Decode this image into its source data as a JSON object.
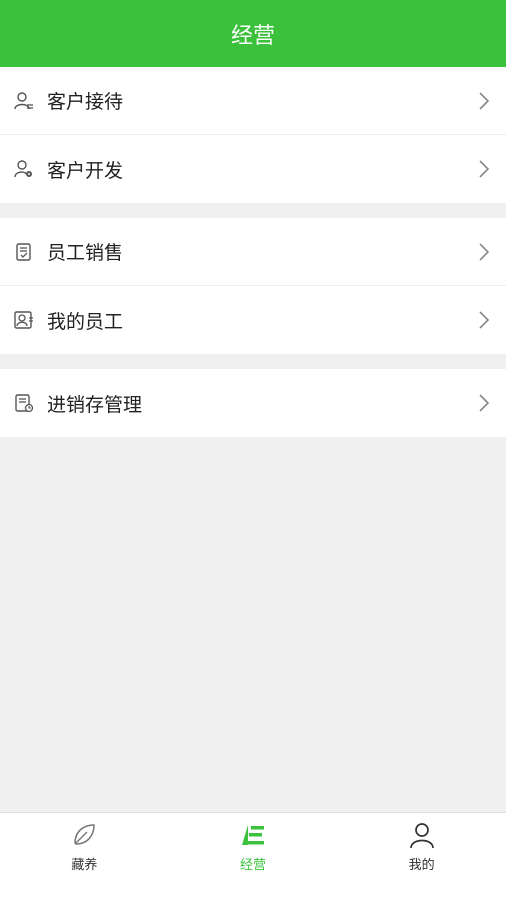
{
  "header": {
    "title": "经营"
  },
  "menu": {
    "group1": [
      {
        "label": "客户接待",
        "icon": "customer-reception-icon"
      },
      {
        "label": "客户开发",
        "icon": "customer-development-icon"
      }
    ],
    "group2": [
      {
        "label": "员工销售",
        "icon": "staff-sales-icon"
      },
      {
        "label": "我的员工",
        "icon": "my-staff-icon"
      }
    ],
    "group3": [
      {
        "label": "进销存管理",
        "icon": "inventory-management-icon"
      }
    ]
  },
  "tabbar": {
    "tabs": [
      {
        "label": "藏养",
        "icon": "leaf-icon",
        "active": false
      },
      {
        "label": "经营",
        "icon": "business-icon",
        "active": true
      },
      {
        "label": "我的",
        "icon": "person-icon",
        "active": false
      }
    ]
  },
  "colors": {
    "accent": "#3cc13c",
    "background": "#f0f0f0"
  }
}
